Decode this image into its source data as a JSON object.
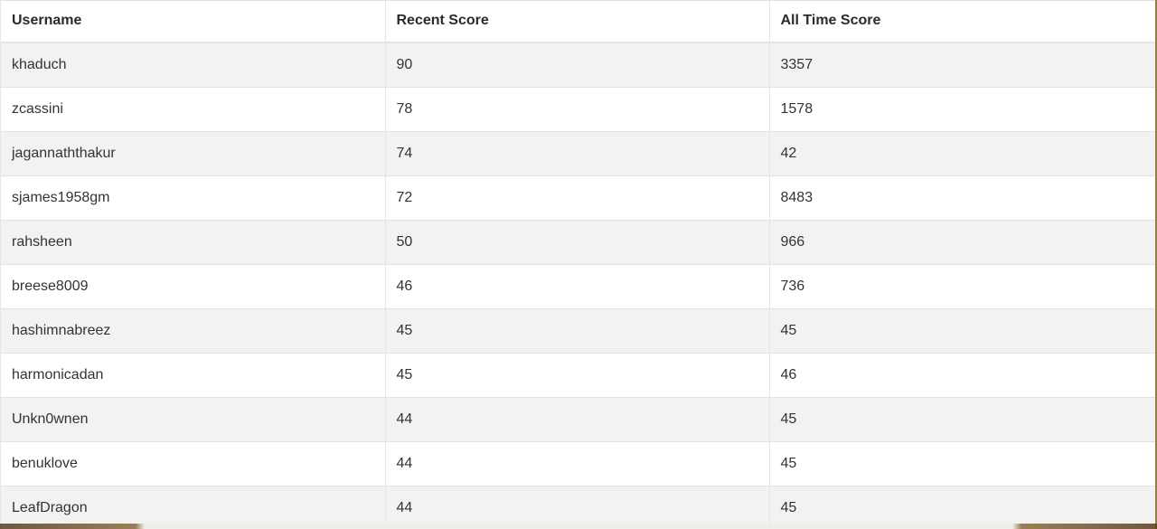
{
  "table": {
    "columns": [
      "Username",
      "Recent Score",
      "All Time Score"
    ],
    "rows": [
      {
        "username": "khaduch",
        "recent": "90",
        "alltime": "3357"
      },
      {
        "username": "zcassini",
        "recent": "78",
        "alltime": "1578"
      },
      {
        "username": "jagannaththakur",
        "recent": "74",
        "alltime": "42"
      },
      {
        "username": "sjames1958gm",
        "recent": "72",
        "alltime": "8483"
      },
      {
        "username": "rahsheen",
        "recent": "50",
        "alltime": "966"
      },
      {
        "username": "breese8009",
        "recent": "46",
        "alltime": "736"
      },
      {
        "username": "hashimnabreez",
        "recent": "45",
        "alltime": "45"
      },
      {
        "username": "harmonicadan",
        "recent": "45",
        "alltime": "46"
      },
      {
        "username": "Unkn0wnen",
        "recent": "44",
        "alltime": "45"
      },
      {
        "username": "benuklove",
        "recent": "44",
        "alltime": "45"
      },
      {
        "username": "LeafDragon",
        "recent": "44",
        "alltime": "45"
      }
    ]
  },
  "colors": {
    "row_stripe": "#f2f2f2",
    "row_plain": "#ffffff",
    "text": "#333333"
  }
}
